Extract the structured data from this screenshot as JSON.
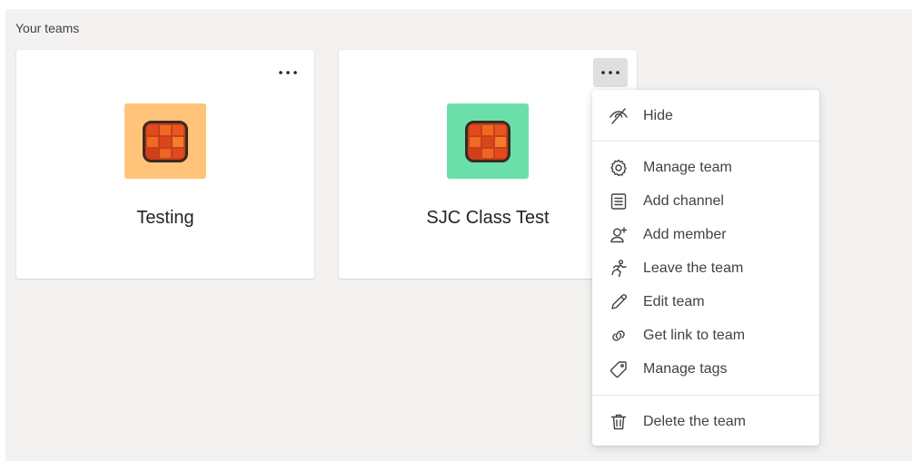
{
  "section": {
    "title": "Your teams"
  },
  "teams": [
    {
      "name": "Testing",
      "avatar_bg": "#ffc47a"
    },
    {
      "name": "SJC Class Test",
      "avatar_bg": "#6bdfaa"
    }
  ],
  "more_options": {
    "icon": "more-horizontal-icon"
  },
  "context_menu": {
    "items": [
      {
        "label": "Hide",
        "icon": "hide-icon"
      },
      {
        "label": "Manage team",
        "icon": "gear-icon"
      },
      {
        "label": "Add channel",
        "icon": "channel-icon"
      },
      {
        "label": "Add member",
        "icon": "add-member-icon"
      },
      {
        "label": "Leave the team",
        "icon": "leave-icon"
      },
      {
        "label": "Edit team",
        "icon": "pencil-icon"
      },
      {
        "label": "Get link to team",
        "icon": "link-icon"
      },
      {
        "label": "Manage tags",
        "icon": "tag-icon"
      },
      {
        "label": "Delete the team",
        "icon": "trash-icon"
      }
    ]
  },
  "colors": {
    "canvas_bg": "#f3f2f1",
    "card_bg": "#ffffff",
    "avatar_tile_dark": "#c6401a",
    "avatar_tile_light": "#f06a23"
  }
}
